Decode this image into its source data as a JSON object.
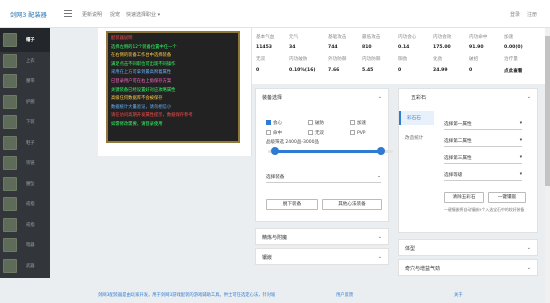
{
  "header": {
    "logo": "剑网3 配装器",
    "nav": [
      "更新说明",
      "捉宠",
      "快速选择职业 ▾"
    ],
    "login": "登录",
    "register": "注册"
  },
  "sidebar": {
    "items": [
      {
        "label": "帽子"
      },
      {
        "label": "上衣"
      },
      {
        "label": "腰带"
      },
      {
        "label": "护腕"
      },
      {
        "label": "下装"
      },
      {
        "label": "鞋子"
      },
      {
        "label": "项链"
      },
      {
        "label": "腰坠"
      },
      {
        "label": "戒指"
      },
      {
        "label": "戒指"
      },
      {
        "label": "暗器"
      },
      {
        "label": "武器"
      }
    ]
  },
  "notice": {
    "lines": [
      "配装器说明",
      "选择左侧的12个装备位置中任一个",
      "在右侧的装备工作台中选择装备",
      "满足点击不同职位可出现不同操作",
      "采用在上方可拿到最高附着属性",
      "已登录用户可在右上角保存方案",
      "关键装备已经设置好对应攻略属性",
      "高级任何数据库不会被保存",
      "数据统计大量验证，请勿相信小",
      "请在访问高期开发属性提示，数据保存参考",
      "如需修改需要，请登录使用"
    ],
    "colors": [
      "#ff4d4d",
      "#33ff66",
      "#ffd24d",
      "#33ff66",
      "#66b3ff",
      "#ff66cc",
      "#33ff66",
      "#ffd24d",
      "#66b3ff",
      "#ff4d4d",
      "#33ff66"
    ]
  },
  "stats": {
    "headers1": [
      "基本气血",
      "元气",
      "基础攻击",
      "最低攻击",
      "内功会心",
      "内功会效",
      "内功命中",
      "加速"
    ],
    "values1": [
      "11453",
      "34",
      "744",
      "810",
      "0.14",
      "175.00",
      "91.90",
      "0.00(0)"
    ],
    "headers2": [
      "无双",
      "内功破防",
      "外功防御",
      "内功防御",
      "御劲",
      "化劲",
      "破招",
      "治疗量"
    ],
    "values2": [
      "0",
      "0.10%(16)",
      "7.66",
      "5.45",
      "0",
      "24.99",
      "0",
      "点此查看"
    ]
  },
  "equip_filter": {
    "title": "装备选择",
    "checkboxes": [
      {
        "label": "会心",
        "checked": true
      },
      {
        "label": "破防",
        "checked": false
      },
      {
        "label": "加速",
        "checked": false
      },
      {
        "label": "命中",
        "checked": false
      },
      {
        "label": "无双",
        "checked": false
      },
      {
        "label": "PVP",
        "checked": false
      }
    ],
    "range_label": "品级筛选 2400品-3000品",
    "range": {
      "min": 2400,
      "max": 3000,
      "low": 2400,
      "high": 3000
    },
    "select_label": "选择装备",
    "btn_unequip": "脱下装备",
    "btn_other": "其他心法装备"
  },
  "enchant": {
    "title": "精炼与附魔"
  },
  "inlay": {
    "title": "镶嵌"
  },
  "stone": {
    "title": "五彩石",
    "tabs": [
      "彩石石",
      "改造统计"
    ],
    "selects": [
      "选择第一属性",
      "选择第二属性",
      "选择第三属性",
      "选择等级"
    ],
    "btn_clear": "清除五彩石",
    "btn_confirm": "一键镶嵌",
    "note": "一键镶嵌将自动镶嵌5个入选宝石中的较好装备"
  },
  "body_type": {
    "title": "体型"
  },
  "qixue": {
    "title": "奇穴与增益气劲"
  },
  "footer": {
    "text": "剑网3配装器是由玩家开发，用于剑网3游戏配装的游戏辅助工具。供士可任选定心法，针对坡",
    "link1": "用户反馈",
    "link2": "关于"
  },
  "colors": {
    "accent": "#2e7bd1",
    "notice_bg": "#222222",
    "sidebar_bg": "#32363b"
  }
}
